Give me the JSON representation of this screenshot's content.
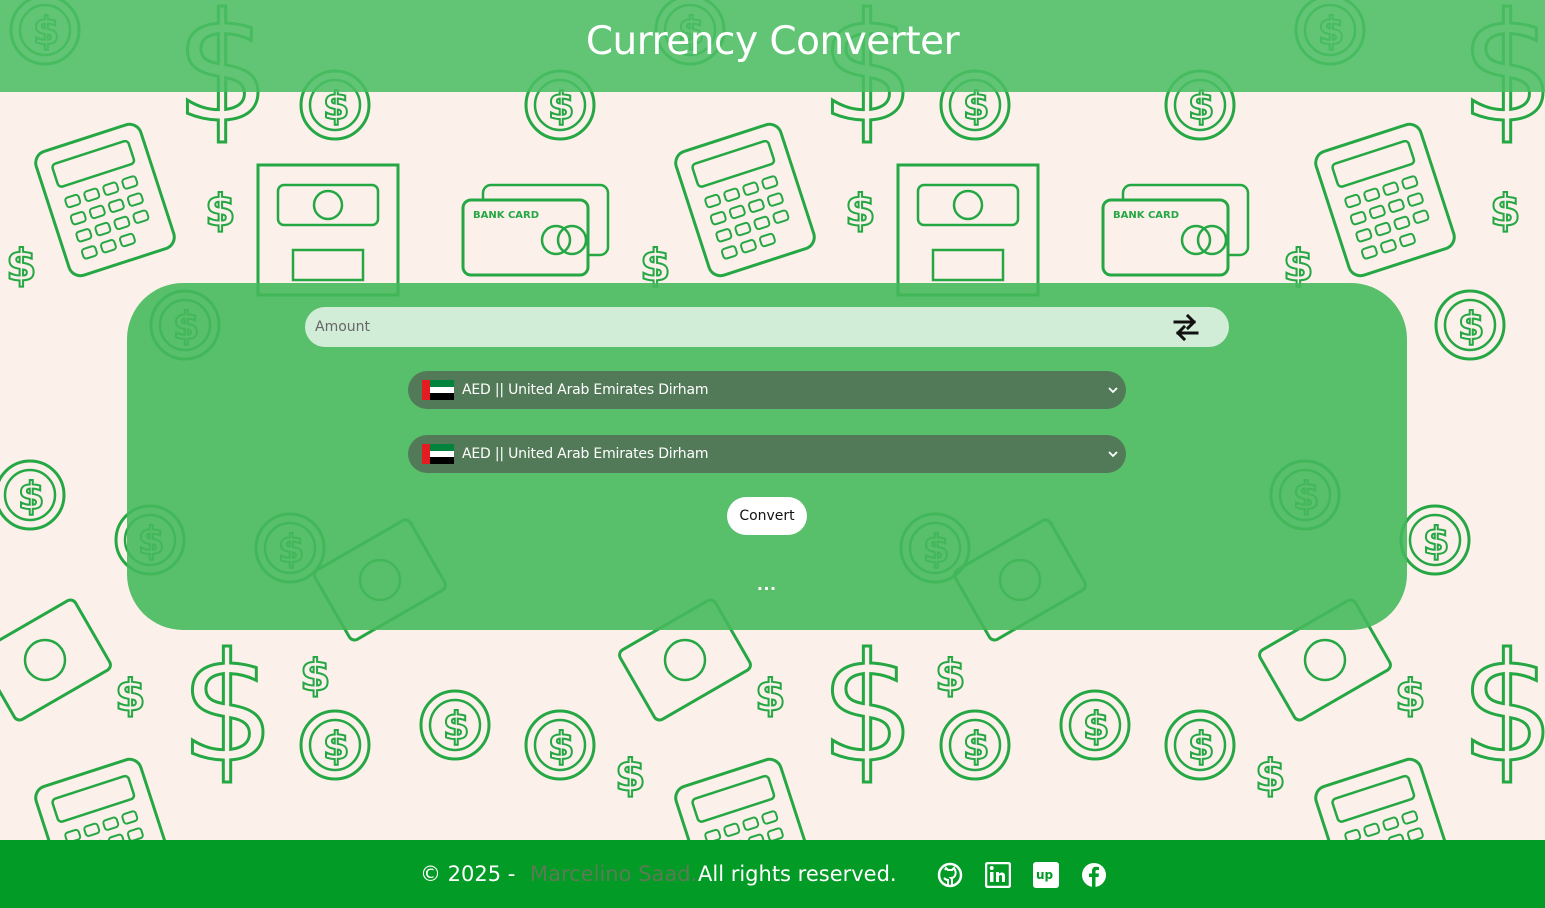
{
  "header": {
    "title": "Currency Converter"
  },
  "converter": {
    "amount_placeholder": "Amount",
    "from_currency": "AED || United Arab Emirates Dirham",
    "to_currency": "AED || United Arab Emirates Dirham",
    "convert_label": "Convert",
    "result_text": "..."
  },
  "footer": {
    "copyright": "© 2025 -",
    "author": "Marcelino Saad.",
    "rights": "All rights reserved.",
    "social_icons": [
      "github-icon",
      "linkedin-icon",
      "upwork-icon",
      "facebook-icon"
    ]
  },
  "colors": {
    "header_bg": "#4cbe64",
    "panel_bg": "#46b95c",
    "footer_bg": "#019b26",
    "page_bg": "#fbf0ea",
    "pattern_green": "#1aa33c"
  }
}
